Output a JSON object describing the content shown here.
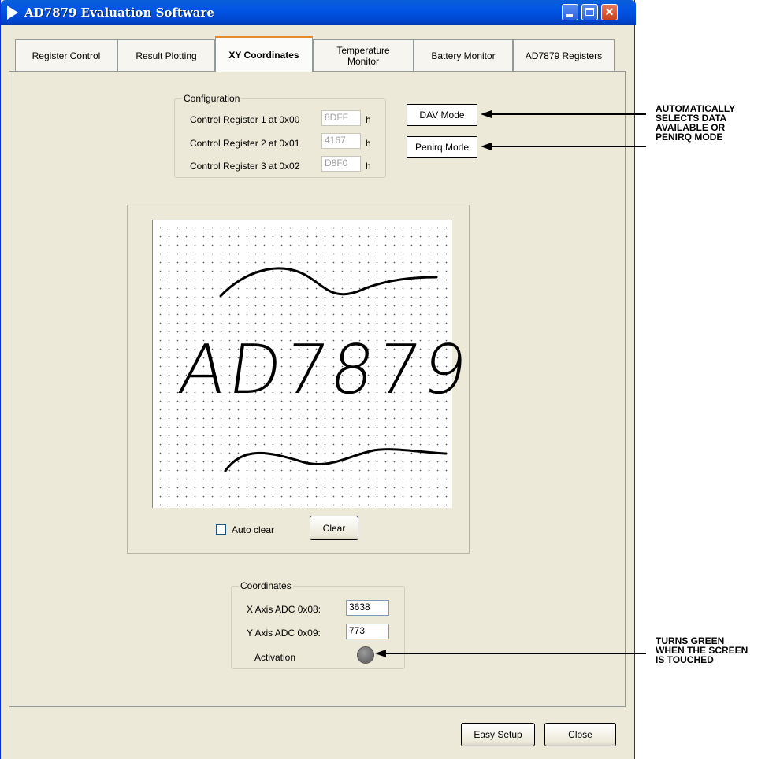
{
  "window": {
    "title": "AD7879 Evaluation Software"
  },
  "tabs": [
    {
      "label": "Register Control"
    },
    {
      "label": "Result Plotting"
    },
    {
      "label": "XY Coordinates"
    },
    {
      "label": "Temperature\nMonitor"
    },
    {
      "label": "Battery Monitor"
    },
    {
      "label": "AD7879 Registers"
    }
  ],
  "configuration": {
    "title": "Configuration",
    "rows": [
      {
        "label": "Control Register 1 at 0x00",
        "value": "8DFF",
        "unit": "h"
      },
      {
        "label": "Control Register 2 at 0x01",
        "value": "4167",
        "unit": "h"
      },
      {
        "label": "Control Register 3 at 0x02",
        "value": "D8F0",
        "unit": "h"
      }
    ]
  },
  "mode_buttons": {
    "dav": "DAV Mode",
    "penirq": "Penirq Mode"
  },
  "drawing": {
    "auto_clear_label": "Auto clear",
    "clear_label": "Clear",
    "handwriting_text": "AD7879"
  },
  "coordinates": {
    "title": "Coordinates",
    "x_label": "X Axis ADC  0x08:",
    "x_value": "3638",
    "y_label": "Y Axis ADC  0x09:",
    "y_value": "773",
    "activation_label": "Activation"
  },
  "footer": {
    "easy_setup": "Easy Setup",
    "close": "Close"
  },
  "annotations": {
    "mode_note": [
      "AUTOMATICALLY",
      "SELECTS DATA",
      "AVAILABLE OR",
      "PENIRQ MODE"
    ],
    "activation_note": [
      "TURNS GREEN",
      "WHEN THE SCREEN",
      "IS TOUCHED"
    ]
  },
  "colors": {
    "accent": "#0055e5",
    "ink": "#000000"
  }
}
